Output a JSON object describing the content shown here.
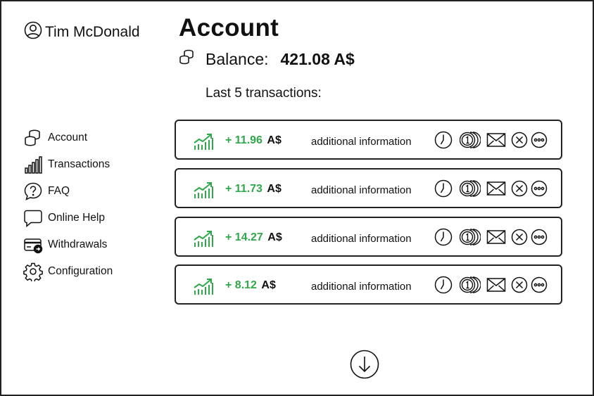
{
  "user": {
    "name": "Tim McDonald",
    "icon": "user-icon"
  },
  "page": {
    "title": "Account"
  },
  "balance": {
    "label": "Balance:",
    "value": "421.08 A$",
    "icon": "coins-stack-icon"
  },
  "transactions_header": "Last 5 transactions:",
  "sidebar": {
    "items": [
      {
        "label": "Account",
        "icon": "coins-stack-icon"
      },
      {
        "label": "Transactions",
        "icon": "bar-chart-icon"
      },
      {
        "label": "FAQ",
        "icon": "question-icon"
      },
      {
        "label": "Online Help",
        "icon": "chat-bubble-icon"
      },
      {
        "label": "Withdrawals",
        "icon": "card-withdraw-icon"
      },
      {
        "label": "Configuration",
        "icon": "gear-icon"
      }
    ]
  },
  "transactions": [
    {
      "amount": "+ 11.96",
      "currency": "A$",
      "info": "additional information"
    },
    {
      "amount": "+ 11.73",
      "currency": "A$",
      "info": "additional information"
    },
    {
      "amount": "+ 14.27",
      "currency": "A$",
      "info": "additional information"
    },
    {
      "amount": "+ 8.12",
      "currency": "A$",
      "info": "additional information"
    }
  ],
  "colors": {
    "positive": "#2ea84a",
    "border": "#222222",
    "text": "#111111"
  },
  "load_more": {
    "icon": "arrow-down-circle-icon"
  }
}
